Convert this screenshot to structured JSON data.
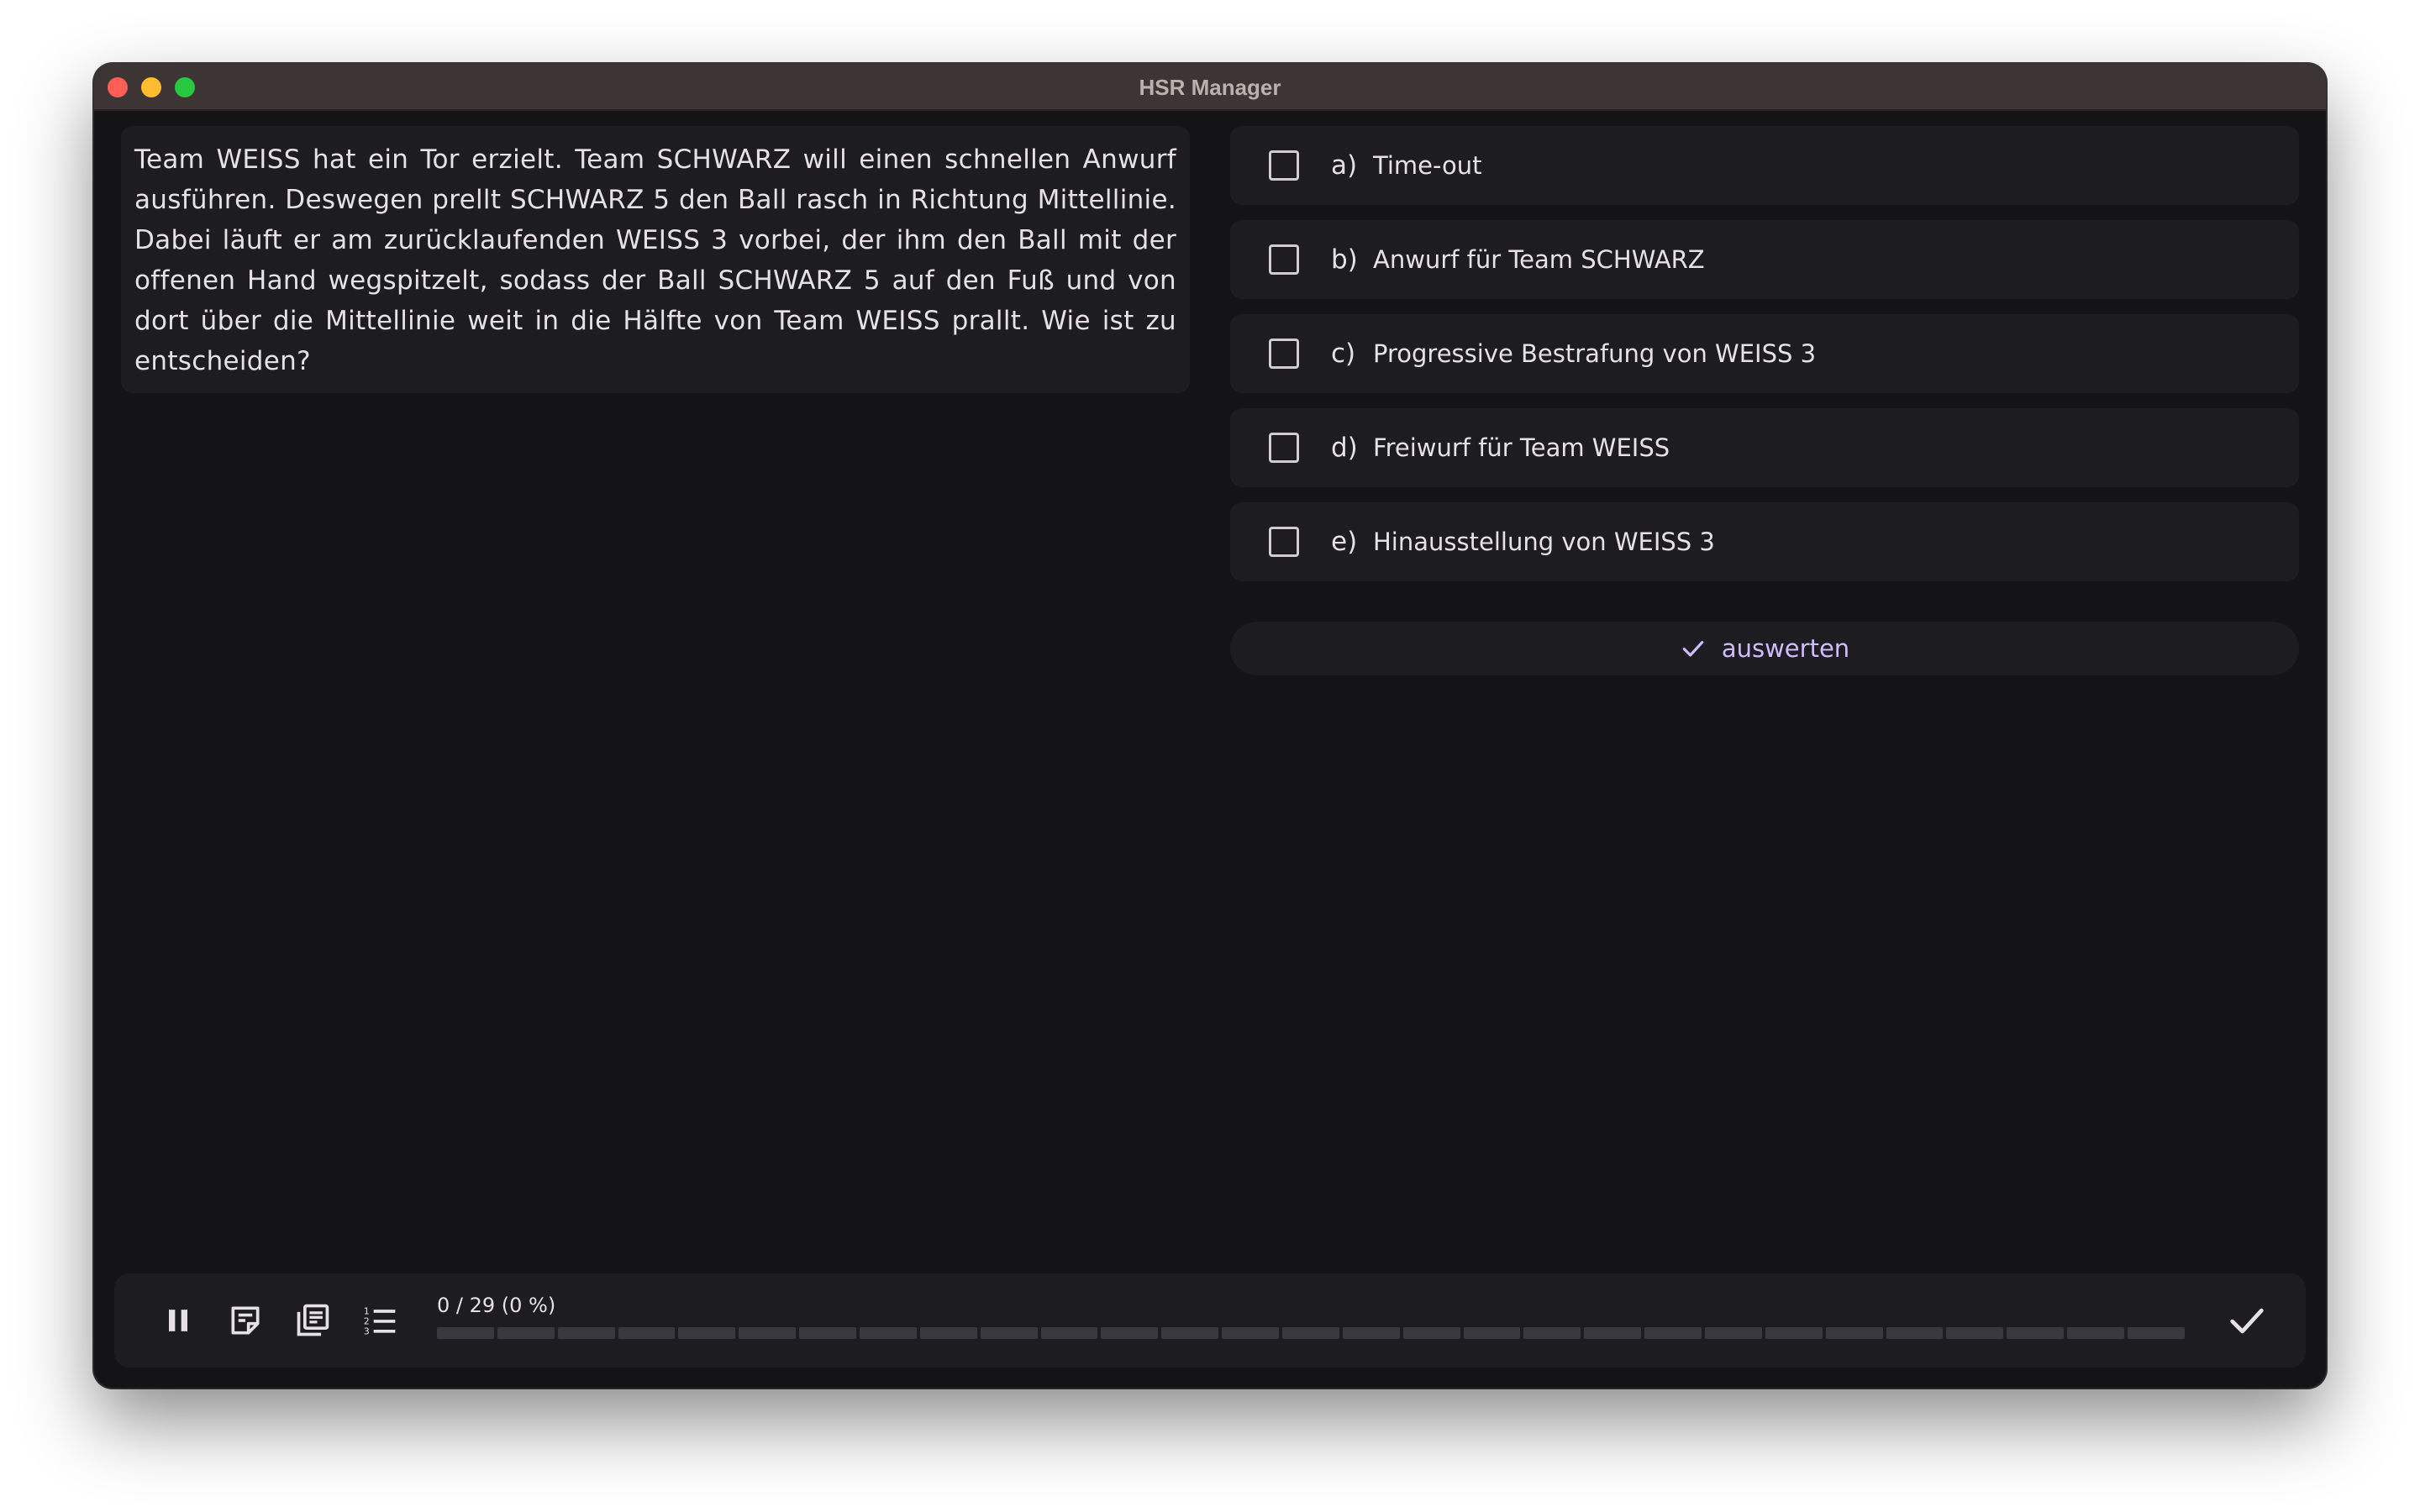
{
  "window": {
    "title": "HSR Manager"
  },
  "question": {
    "text": "Team WEISS hat ein Tor erzielt. Team SCHWARZ will einen schnellen Anwurf ausführen. Deswegen prellt SCHWARZ 5 den Ball rasch in Richtung Mittellinie. Dabei läuft er am zurücklaufenden WEISS 3 vorbei, der ihm den Ball mit der offenen Hand wegspitzelt, sodass der Ball SCHWARZ 5 auf den Fuß und von dort über die Mittellinie weit in die Hälfte von Team WEISS prallt. Wie ist zu entscheiden?"
  },
  "answers": [
    {
      "letter": "a)",
      "text": "Time-out",
      "checked": false
    },
    {
      "letter": "b)",
      "text": "Anwurf für Team SCHWARZ",
      "checked": false
    },
    {
      "letter": "c)",
      "text": "Progressive Bestrafung von WEISS 3",
      "checked": false
    },
    {
      "letter": "d)",
      "text": "Freiwurf für Team WEISS",
      "checked": false
    },
    {
      "letter": "e)",
      "text": "Hinausstellung von WEISS 3",
      "checked": false
    }
  ],
  "evaluate": {
    "label": "auswerten",
    "icon": "check-icon"
  },
  "toolbar": {
    "icons": [
      "pause-icon",
      "note-icon",
      "library-icon",
      "numbered-list-icon",
      "check-icon"
    ],
    "progress_label": "0 / 29 (0 %)",
    "progress": {
      "current": 0,
      "total": 29,
      "percent": 0
    }
  },
  "colors": {
    "background": "#141316",
    "card": "#1d1c20",
    "text": "#e6e1e5",
    "accent": "#d0bcff",
    "titlebar": "#3c3533"
  }
}
